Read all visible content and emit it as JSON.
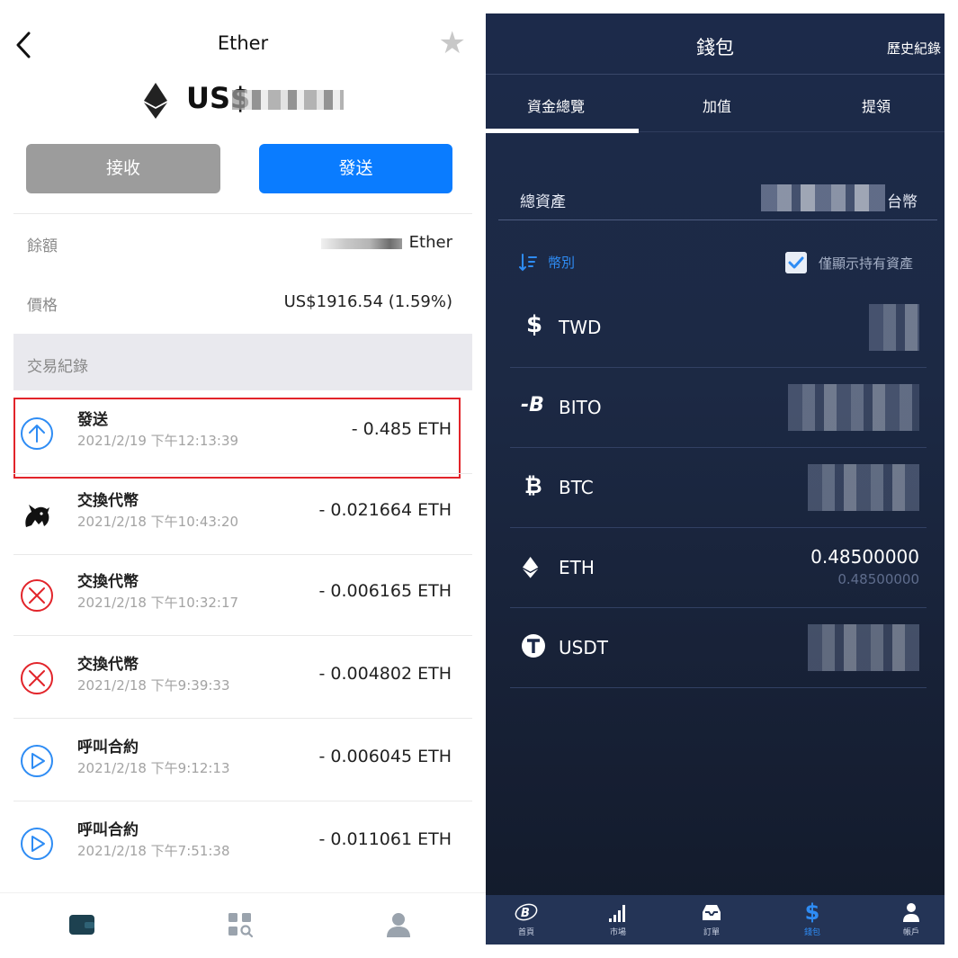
{
  "left": {
    "header": {
      "title": "Ether"
    },
    "balance_prefix": "US$",
    "buttons": {
      "receive": "接收",
      "send": "發送"
    },
    "info": {
      "balance_label": "餘額",
      "balance_unit": "Ether",
      "price_label": "價格",
      "price_value": "US$1916.54 (1.59%)"
    },
    "tx_header": "交易紀錄",
    "transactions": [
      {
        "type": "發送",
        "time": "2021/2/19 下午12:13:39",
        "amount": "- 0.485 ETH",
        "icon": "arrow-up-circle-icon"
      },
      {
        "type": "交換代幣",
        "time": "2021/2/18 下午10:43:20",
        "amount": "- 0.021664 ETH",
        "icon": "unicorn-icon"
      },
      {
        "type": "交換代幣",
        "time": "2021/2/18 下午10:32:17",
        "amount": "- 0.006165 ETH",
        "icon": "x-circle-icon"
      },
      {
        "type": "交換代幣",
        "time": "2021/2/18 下午9:39:33",
        "amount": "- 0.004802 ETH",
        "icon": "x-circle-icon"
      },
      {
        "type": "呼叫合約",
        "time": "2021/2/18 下午9:12:13",
        "amount": "- 0.006045 ETH",
        "icon": "play-circle-icon"
      },
      {
        "type": "呼叫合約",
        "time": "2021/2/18 下午7:51:38",
        "amount": "- 0.011061 ETH",
        "icon": "play-circle-icon"
      }
    ],
    "colors": {
      "send_button": "#0a7cff",
      "receive_button": "#9c9c9c",
      "highlight": "#e2242a",
      "error": "#e2242a",
      "info": "#2e8cf4"
    }
  },
  "right": {
    "header": {
      "title": "錢包",
      "history": "歷史紀錄"
    },
    "tabs": [
      {
        "label": "資金總覽",
        "active": true
      },
      {
        "label": "加值",
        "active": false
      },
      {
        "label": "提領",
        "active": false
      }
    ],
    "total": {
      "label": "總資產",
      "currency": "台幣"
    },
    "filter": {
      "sort_label": "幣別",
      "holdings_only_label": "僅顯示持有資產",
      "holdings_only_checked": true
    },
    "coins": [
      {
        "symbol": "TWD",
        "icon": "dollar-icon"
      },
      {
        "symbol": "BITO",
        "icon": "bito-icon"
      },
      {
        "symbol": "BTC",
        "icon": "bitcoin-icon"
      },
      {
        "symbol": "ETH",
        "icon": "ethereum-icon",
        "value": "0.48500000",
        "sub_value": "0.48500000"
      },
      {
        "symbol": "USDT",
        "icon": "tether-icon"
      }
    ],
    "tabbar": [
      {
        "label": "首頁",
        "icon": "home-logo-icon"
      },
      {
        "label": "市場",
        "icon": "signal-bars-icon"
      },
      {
        "label": "訂單",
        "icon": "inbox-icon"
      },
      {
        "label": "錢包",
        "icon": "dollar-icon",
        "active": true
      },
      {
        "label": "帳戶",
        "icon": "person-icon"
      }
    ],
    "colors": {
      "background": "#1c2a4a",
      "accent": "#2e8cf4"
    }
  }
}
